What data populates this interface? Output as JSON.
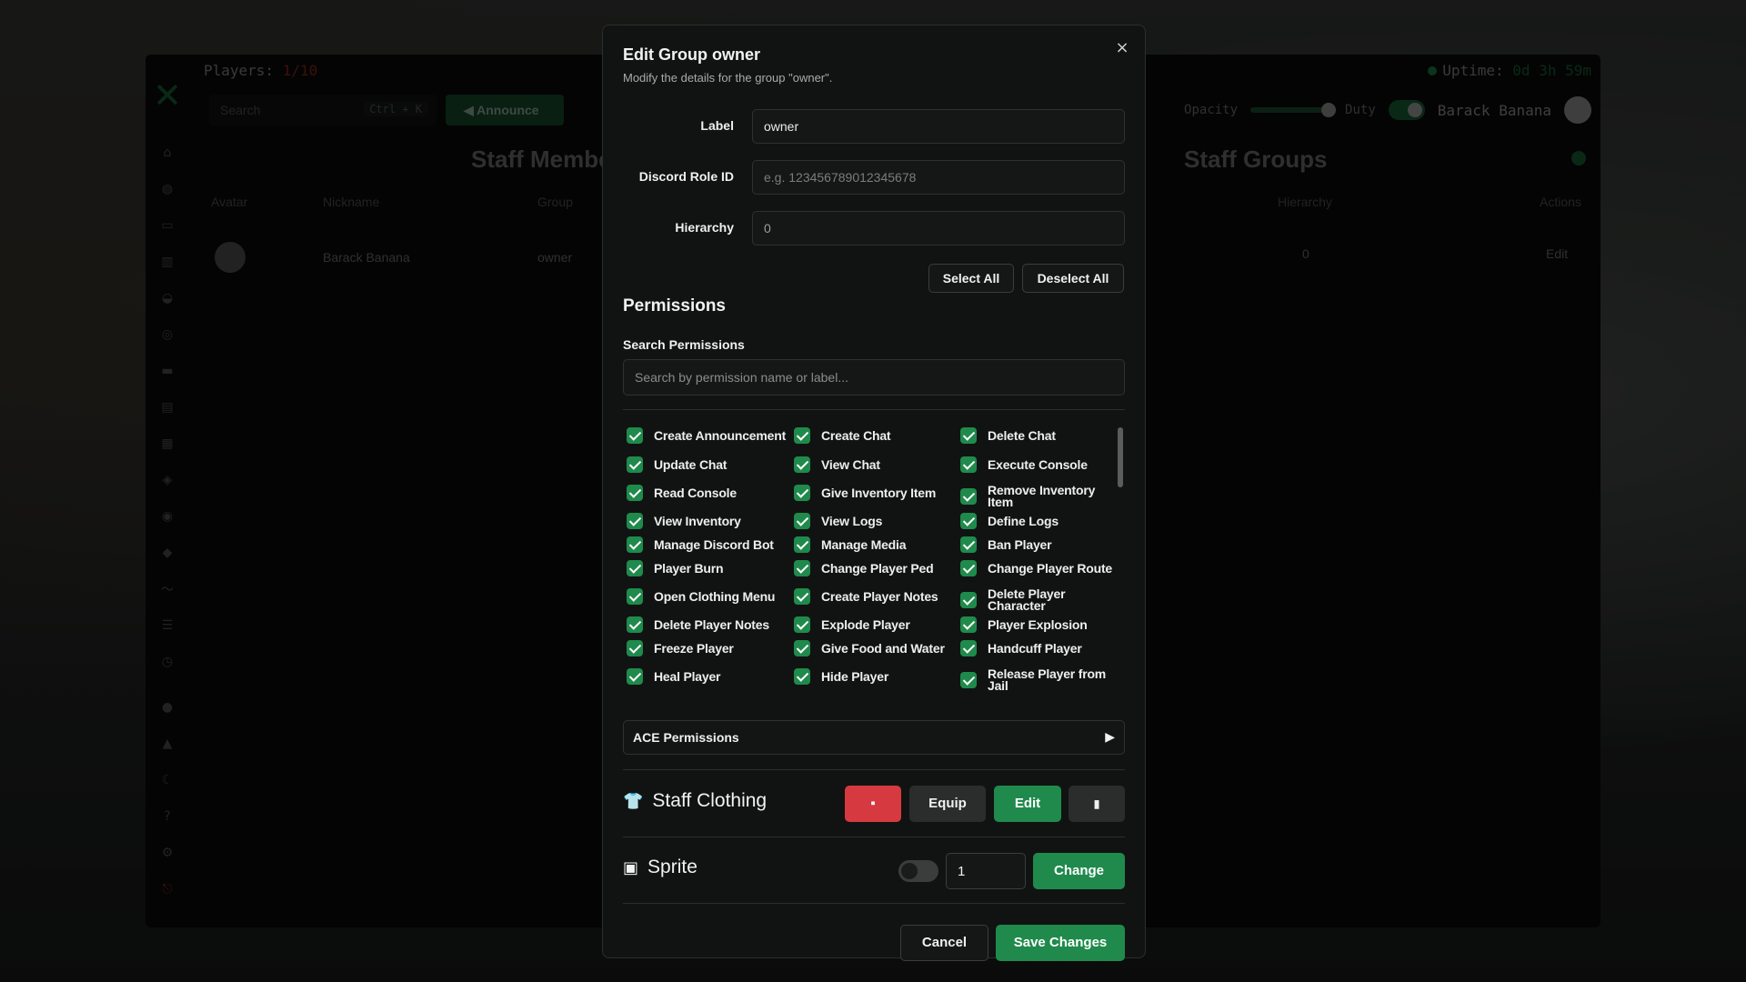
{
  "background_panel": {
    "players_label": "Players:",
    "players_count": "1/10",
    "search_placeholder": "Search",
    "search_shortcut": "Ctrl + K",
    "announce_label": "Announce",
    "uptime_label": "Uptime:",
    "uptime_value": "0d 3h 59m",
    "opacity_label": "Opacity",
    "duty_label": "Duty",
    "user_name": "Barack Banana",
    "staff_members_title": "Staff Membe",
    "staff_groups_title": "Staff Groups",
    "members_columns": [
      "Avatar",
      "Nickname",
      "Group"
    ],
    "members_rows": [
      {
        "nickname": "Barack Banana",
        "group": "owner"
      }
    ],
    "groups_columns": [
      "Hierarchy",
      "Actions"
    ],
    "groups_rows": [
      {
        "hierarchy": "0",
        "action": "Edit"
      }
    ]
  },
  "modal": {
    "title": "Edit Group owner",
    "subtitle": "Modify the details for the group \"owner\".",
    "close_glyph": "×",
    "fields": {
      "label_label": "Label",
      "label_value": "owner",
      "discord_label": "Discord Role ID",
      "discord_placeholder": "e.g. 123456789012345678",
      "hierarchy_label": "Hierarchy",
      "hierarchy_value": "0"
    },
    "permissions_title": "Permissions",
    "select_all": "Select All",
    "deselect_all": "Deselect All",
    "search_perm_label": "Search Permissions",
    "search_perm_placeholder": "Search by permission name or label...",
    "permissions": [
      [
        "Create Announcement",
        "Create Chat",
        "Delete Chat"
      ],
      [
        "Update Chat",
        "View Chat",
        "Execute Console"
      ],
      [
        "Read Console",
        "Give Inventory Item",
        "Remove Inventory Item"
      ],
      [
        "View Inventory",
        "View Logs",
        "Define Logs"
      ],
      [
        "Manage Discord Bot",
        "Manage Media",
        "Ban Player"
      ],
      [
        "Player Burn",
        "Change Player Ped",
        "Change Player Route"
      ],
      [
        "Open Clothing Menu",
        "Create Player Notes",
        "Delete Player Character"
      ],
      [
        "Delete Player Notes",
        "Explode Player",
        "Player Explosion"
      ],
      [
        "Freeze Player",
        "Give Food and Water",
        "Handcuff Player"
      ],
      [
        "Heal Player",
        "Hide Player",
        "Release Player from Jail"
      ]
    ],
    "ace_label": "ACE Permissions",
    "staff_clothing_label": "Staff Clothing",
    "equip_label": "Equip",
    "edit_label": "Edit",
    "sprite_label": "Sprite",
    "sprite_value": "1",
    "change_label": "Change",
    "cancel_label": "Cancel",
    "save_label": "Save Changes"
  }
}
